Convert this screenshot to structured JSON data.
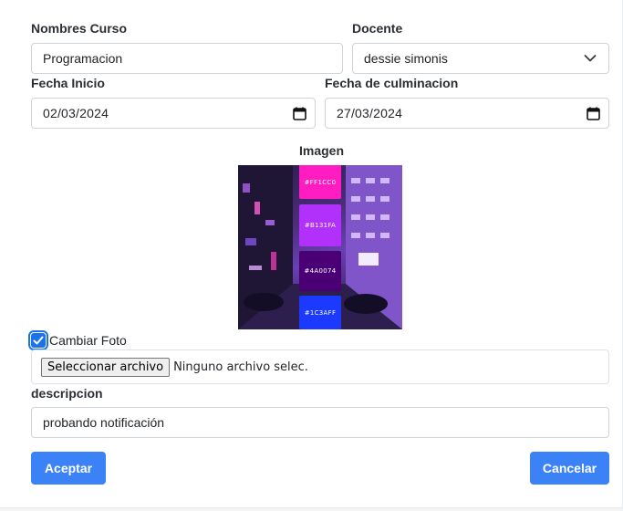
{
  "form": {
    "course_name": {
      "label": "Nombres Curso",
      "value": "Programacion"
    },
    "teacher": {
      "label": "Docente",
      "value": "dessie simonis"
    },
    "start_date": {
      "label": "Fecha Inicio",
      "value": "02/03/2024"
    },
    "end_date": {
      "label": "Fecha de culminacion",
      "value": "27/03/2024"
    },
    "image": {
      "label": "Imagen",
      "swatches": [
        {
          "hex": "#FF1CC0",
          "label": "#FF1CC0"
        },
        {
          "hex": "#B131FA",
          "label": "#B131FA"
        },
        {
          "hex": "#4A0074",
          "label": "#4A0074"
        },
        {
          "hex": "#1C3AFF",
          "label": "#1C3AFF"
        }
      ]
    },
    "change_photo": {
      "label": "Cambiar Foto",
      "checked": true
    },
    "file_input": {
      "button_label": "Seleccionar archivo",
      "status": "Ninguno archivo selec."
    },
    "description": {
      "label": "descripcion",
      "value": "probando notificación"
    }
  },
  "actions": {
    "accept_label": "Aceptar",
    "cancel_label": "Cancelar"
  },
  "colors": {
    "primary": "#3b82f6",
    "checkbox": "#1a73e8"
  }
}
